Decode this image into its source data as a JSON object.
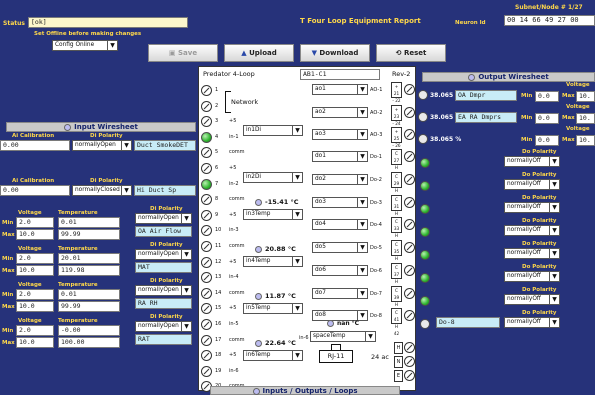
{
  "status": {
    "label": "Status",
    "value": "[ok]"
  },
  "offline_hint": "Set Offline before making changes",
  "mode_select": "Config Online",
  "title": "Four Loop Equipment Report",
  "node": {
    "label": "Neuron Id",
    "value": "00 14 66 49 27 00",
    "subnet": "Subnet/Node # 1/27"
  },
  "buttons": {
    "save": "Save",
    "upload": "Upload",
    "download": "Download",
    "reset": "Reset"
  },
  "board": {
    "name": "Predator 4-Loop",
    "id": "AB1-C1",
    "rev": "Rev-2",
    "network": "Network",
    "rj": "RJ-11",
    "ac": "24 ac",
    "nan": "nan °C",
    "spacetemp": "spaceTemp",
    "in6": "in-6"
  },
  "input_header": "Input Wiresheet",
  "output_header": "Output Wiresheet",
  "footer": "Inputs / Outputs / Loops",
  "labels": {
    "ai_cal": "Ai Calibration",
    "di_pol": "Di Polarity",
    "voltage": "Voltage",
    "temperature": "Temperature",
    "do_pol": "Do Polarity",
    "min": "Min",
    "max": "Max"
  },
  "inputs_di": [
    {
      "cal": "0.00",
      "pol": "normallyOpen",
      "name": "Duct SmokeDET"
    },
    {
      "cal": "0.00",
      "pol": "normallyClosed",
      "name": "Hi Duct Sp"
    }
  ],
  "inputs_ai": [
    {
      "vmin": "2.0",
      "vmax": "10.0",
      "tmin": "0.01",
      "tmax": "99.99",
      "pol": "normallyOpen",
      "name": "OA Air Flow"
    },
    {
      "vmin": "2.0",
      "vmax": "10.0",
      "tmin": "20.01",
      "tmax": "119.98",
      "pol": "normallyOpen",
      "name": "MAT"
    },
    {
      "vmin": "2.0",
      "vmax": "10.0",
      "tmin": "0.01",
      "tmax": "99.99",
      "pol": "normallyOpen",
      "name": "RA RH"
    },
    {
      "vmin": "2.0",
      "vmax": "10.0",
      "tmin": "-0.00",
      "tmax": "100.00",
      "pol": "normallyOpen",
      "name": "RAT"
    }
  ],
  "board_inputs": [
    {
      "sel": "in1Di"
    },
    {
      "sel": "in2Di"
    },
    {
      "temp": "-15.41 °C",
      "sel": "in3Temp"
    },
    {
      "temp": "20.88 °C",
      "sel": "in4Temp"
    },
    {
      "temp": "11.87 °C",
      "sel": "in5Temp"
    },
    {
      "temp": "22.64 °C",
      "sel": "in6Temp"
    }
  ],
  "pins": {
    "left": [
      {
        "n": "1",
        "l": ""
      },
      {
        "n": "2",
        "l": ""
      },
      {
        "n": "3",
        "l": "+5"
      },
      {
        "n": "4",
        "l": "in-1"
      },
      {
        "n": "5",
        "l": "comm"
      },
      {
        "n": "6",
        "l": "+5"
      },
      {
        "n": "7",
        "l": "in-2"
      },
      {
        "n": "8",
        "l": "comm"
      },
      {
        "n": "9",
        "l": "+5"
      },
      {
        "n": "10",
        "l": "in-3"
      },
      {
        "n": "11",
        "l": "comm"
      },
      {
        "n": "12",
        "l": "+5"
      },
      {
        "n": "13",
        "l": "in-4"
      },
      {
        "n": "14",
        "l": "comm"
      },
      {
        "n": "15",
        "l": "+5"
      },
      {
        "n": "16",
        "l": "in-5"
      },
      {
        "n": "17",
        "l": "comm"
      },
      {
        "n": "18",
        "l": "+5"
      },
      {
        "n": "19",
        "l": "in-6"
      },
      {
        "n": "20",
        "l": "comm"
      }
    ],
    "right": [
      {
        "sel": "ao1",
        "lab": "AO-1",
        "t": "+ 21\n- 22"
      },
      {
        "sel": "ao2",
        "lab": "AO-2",
        "t": "+ 23\n- 24"
      },
      {
        "sel": "ao3",
        "lab": "AO-3",
        "t": "+ 25\n- 26"
      },
      {
        "sel": "do1",
        "lab": "Do-1",
        "t": "C 27\nH 28"
      },
      {
        "sel": "do2",
        "lab": "Do-2",
        "t": "C 29\nH 30"
      },
      {
        "sel": "do3",
        "lab": "Do-3",
        "t": "C 31\nH 32"
      },
      {
        "sel": "do4",
        "lab": "Do-4",
        "t": "C 33\nH 34"
      },
      {
        "sel": "do5",
        "lab": "Do-5",
        "t": "C 35\nH 36"
      },
      {
        "sel": "do6",
        "lab": "Do-6",
        "t": "C 37\nH 38"
      },
      {
        "sel": "do7",
        "lab": "Do-7",
        "t": "C 39\nH 40"
      },
      {
        "sel": "do8",
        "lab": "Do-8",
        "t": "C 41\nH 42"
      }
    ]
  },
  "outputs_ao": [
    {
      "value": "38.065 %",
      "name": "OA Dmpr",
      "min": "0.0",
      "max": "10."
    },
    {
      "value": "38.065 %",
      "name": "EA RA Dmprs",
      "min": "0.0",
      "max": "10."
    },
    {
      "value": "38.065 %",
      "name": "",
      "min": "0.0",
      "max": "10."
    }
  ],
  "outputs_do": [
    {
      "pol": "normallyOff",
      "name": ""
    },
    {
      "pol": "normallyOff",
      "name": ""
    },
    {
      "pol": "normallyOff",
      "name": ""
    },
    {
      "pol": "normallyOff",
      "name": ""
    },
    {
      "pol": "normallyOff",
      "name": ""
    },
    {
      "pol": "normallyOff",
      "name": ""
    },
    {
      "pol": "normallyOff",
      "name": ""
    },
    {
      "pol": "normallyOff",
      "name": "Do-8"
    }
  ],
  "hne": [
    "H",
    "N",
    "E"
  ]
}
